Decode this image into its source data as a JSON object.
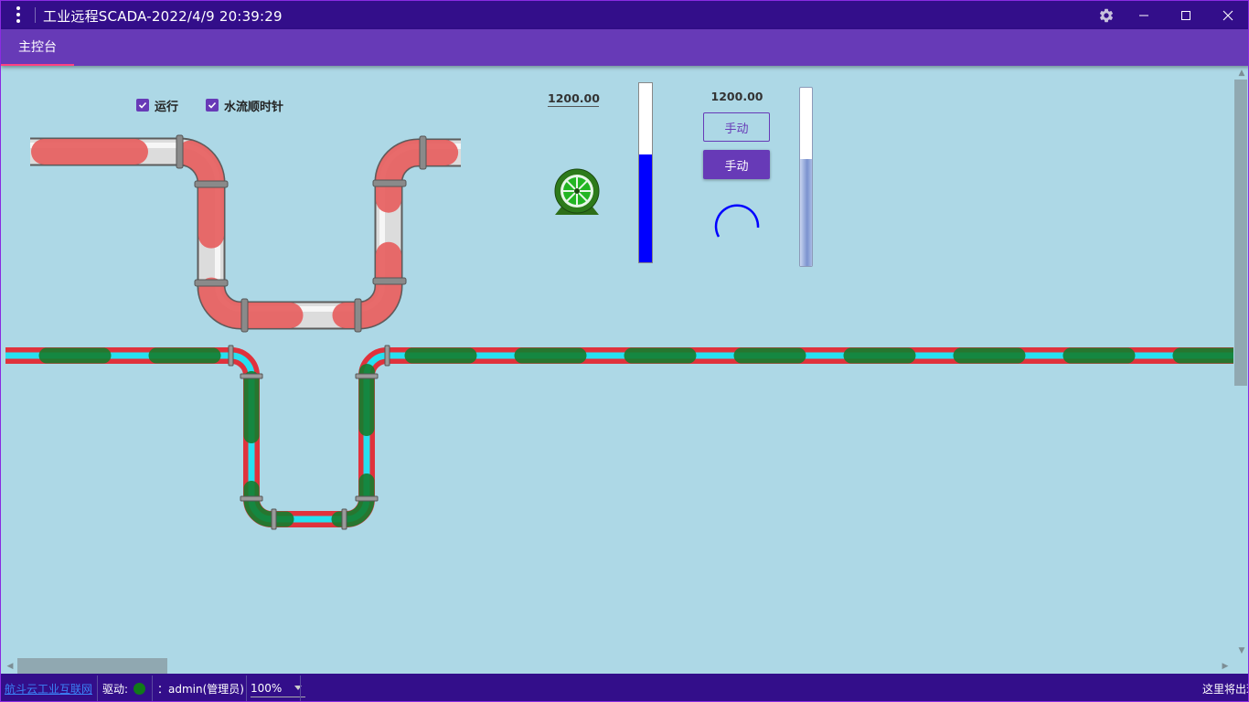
{
  "window": {
    "title": "工业远程SCADA-2022/4/9 20:39:29"
  },
  "tabs": [
    {
      "label": "主控台",
      "active": true
    }
  ],
  "checkboxes": {
    "run": {
      "label": "运行",
      "checked": true
    },
    "clockwise": {
      "label": "水流顺时针",
      "checked": true
    }
  },
  "values": {
    "value_a": "1200.00",
    "value_b": "1200.00"
  },
  "buttons": {
    "manual_outline": "手动",
    "manual_filled": "手动"
  },
  "tanks": {
    "tank1_level": 0.6,
    "tank2_level": 0.6
  },
  "statusbar": {
    "link": "航斗云工业互联网",
    "drive_label": "驱动:",
    "user": "：admin(管理员)",
    "zoom": "100%",
    "message": "这里将出现"
  },
  "colors": {
    "titlebar": "#330e8a",
    "tabbar": "#673ab7",
    "canvas": "#add8e6",
    "accent": "#673ab7",
    "tank_fill": "#0000ff",
    "led": "#11791a"
  }
}
